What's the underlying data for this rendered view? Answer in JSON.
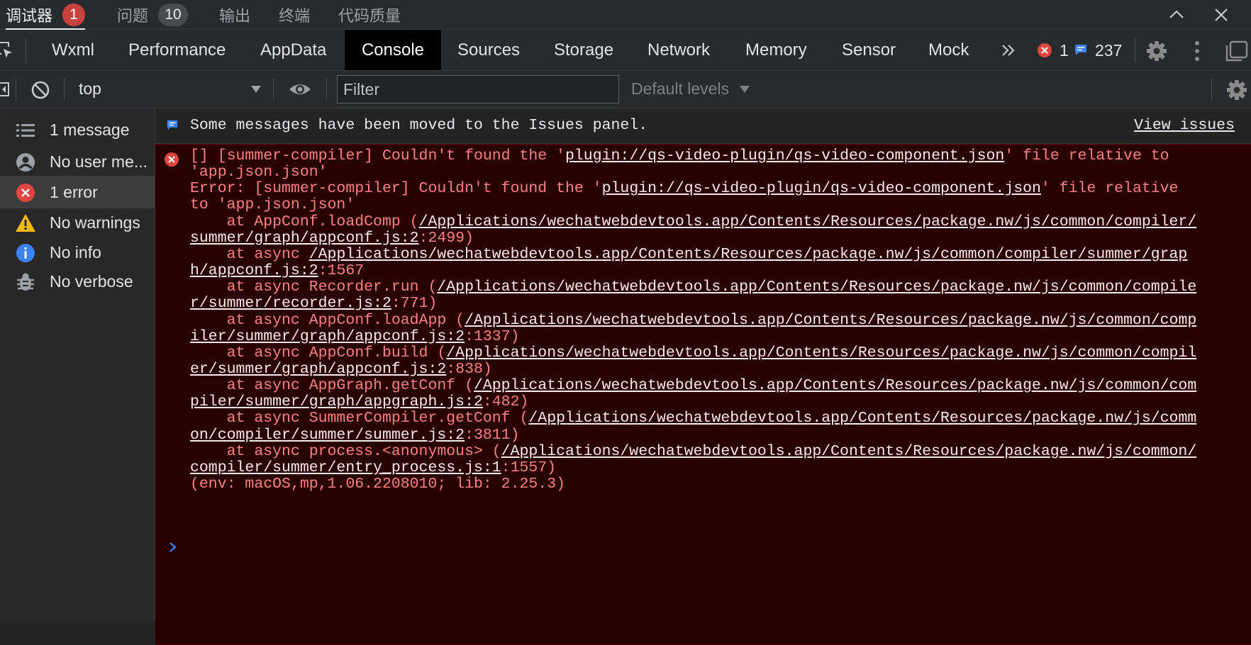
{
  "top_tabs": [
    {
      "label": "调试器",
      "badge": "1",
      "active": true
    },
    {
      "label": "问题",
      "badge": "10"
    },
    {
      "label": "输出"
    },
    {
      "label": "终端"
    },
    {
      "label": "代码质量"
    }
  ],
  "main_tabs": [
    "Wxml",
    "Performance",
    "AppData",
    "Console",
    "Sources",
    "Storage",
    "Network",
    "Memory",
    "Sensor",
    "Mock"
  ],
  "active_main_tab": "Console",
  "status": {
    "errors": "1",
    "messages": "237"
  },
  "toolbar": {
    "context": "top",
    "filter_placeholder": "Filter",
    "levels": "Default levels"
  },
  "sidebar": {
    "items": [
      {
        "label": "1 message",
        "icon": "list-icon"
      },
      {
        "label": "No user me...",
        "icon": "user-icon"
      },
      {
        "label": "1 error",
        "icon": "error-icon"
      },
      {
        "label": "No warnings",
        "icon": "warning-icon"
      },
      {
        "label": "No info",
        "icon": "info-icon"
      },
      {
        "label": "No verbose",
        "icon": "bug-icon"
      }
    ]
  },
  "console": {
    "info_message": "Some messages have been moved to the Issues panel.",
    "view_issues": "View issues",
    "error_lines": [
      [
        "[] [summer-compiler] Couldn't found the '",
        "#plugin://qs-video-plugin/qs-video-component.json",
        "' file relative to"
      ],
      [
        "'app.json.json'"
      ],
      [
        "Error: [summer-compiler] Couldn't found the '",
        "#plugin://qs-video-plugin/qs-video-component.json",
        "' file relative"
      ],
      [
        "to 'app.json.json'"
      ],
      [
        "    at AppConf.loadComp (",
        "#/Applications/wechatwebdevtools.app/Contents/Resources/package.nw/js/common/compiler/"
      ],
      [
        "#summer/graph/appconf.js:2",
        ":2499)"
      ],
      [
        "    at async ",
        "#/Applications/wechatwebdevtools.app/Contents/Resources/package.nw/js/common/compiler/summer/grap"
      ],
      [
        "#h/appconf.js:2",
        ":1567"
      ],
      [
        "    at async Recorder.run (",
        "#/Applications/wechatwebdevtools.app/Contents/Resources/package.nw/js/common/compile"
      ],
      [
        "#r/summer/recorder.js:2",
        ":771)"
      ],
      [
        "    at async AppConf.loadApp (",
        "#/Applications/wechatwebdevtools.app/Contents/Resources/package.nw/js/common/comp"
      ],
      [
        "#iler/summer/graph/appconf.js:2",
        ":1337)"
      ],
      [
        "    at async AppConf.build (",
        "#/Applications/wechatwebdevtools.app/Contents/Resources/package.nw/js/common/compil"
      ],
      [
        "#er/summer/graph/appconf.js:2",
        ":838)"
      ],
      [
        "    at async AppGraph.getConf (",
        "#/Applications/wechatwebdevtools.app/Contents/Resources/package.nw/js/common/com"
      ],
      [
        "#piler/summer/graph/appgraph.js:2",
        ":482)"
      ],
      [
        "    at async SummerCompiler.getConf (",
        "#/Applications/wechatwebdevtools.app/Contents/Resources/package.nw/js/comm"
      ],
      [
        "#on/compiler/summer/summer.js:2",
        ":3811)"
      ],
      [
        "    at async process.<anonymous> (",
        "#/Applications/wechatwebdevtools.app/Contents/Resources/package.nw/js/common/"
      ],
      [
        "#compiler/summer/entry_process.js:1",
        ":1557)"
      ],
      [
        "(env: macOS,mp,1.06.2208010; lib: 2.25.3)"
      ]
    ]
  },
  "colors": {
    "error_text": "#ff8080",
    "error_background": "#290000",
    "badge_red": "#c9433e",
    "info_blue": "#3b82f6"
  }
}
